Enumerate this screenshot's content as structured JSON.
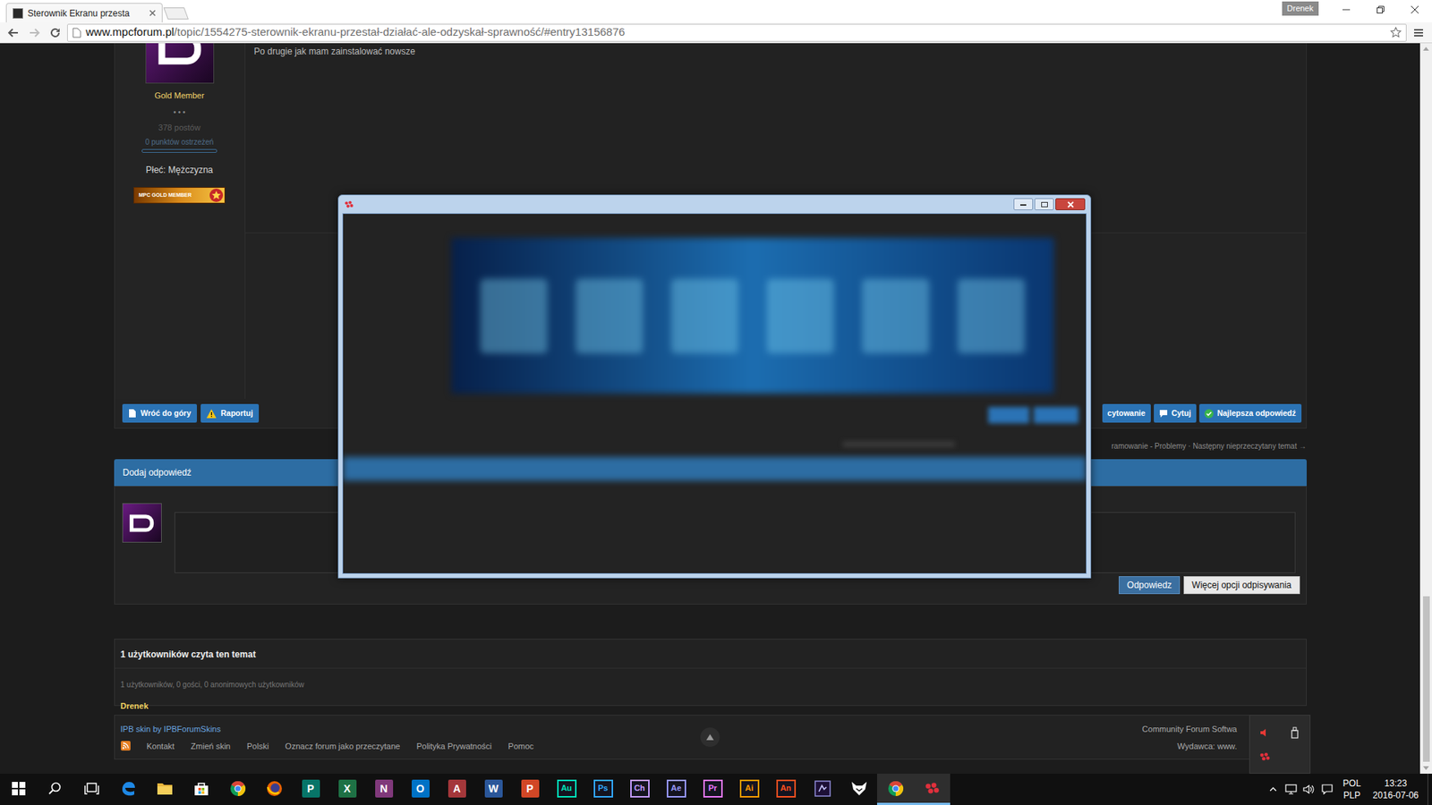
{
  "browser": {
    "tab": {
      "title": "Sterownik Ekranu przesta",
      "selected": true
    },
    "profile": "Drenek",
    "url": {
      "host": "www.mpcforum.pl",
      "path": "/topic/1554275-sterownik-ekranu-przestał-działać-ale-odzyskał-sprawność/#entry13156876"
    },
    "bookmarked": false
  },
  "post": {
    "text": "Po drugie jak mam zainstalować nowsze",
    "author": {
      "rank": "Gold Member",
      "dots": "• • •",
      "posts": "378 postów",
      "warnings": "0 punktów ostrzeżeń",
      "warning_level": 0,
      "gender": "Płeć: Mężczyzna",
      "badge": "MPC GOLD MEMBER"
    },
    "actions_left": [
      {
        "label": "Wróć do góry"
      },
      {
        "label": "Raportuj"
      }
    ],
    "actions_right": [
      {
        "label": "cytowanie"
      },
      {
        "label": "Cytuj"
      },
      {
        "label": "Najlepsza odpowiedź"
      }
    ]
  },
  "topic_nav": "ramowanie - Problemy · Następny nieprzeczytany temat →",
  "reply": {
    "title": "Dodaj odpowiedź",
    "buttons": [
      {
        "label": "Odpowiedz",
        "primary": true
      },
      {
        "label": "Więcej opcji odpisywania",
        "primary": false
      }
    ]
  },
  "readers": {
    "title": "1 użytkowników czyta ten temat",
    "summary": "1 użytkowników, 0 gości, 0 anonimowych użytkowników",
    "users": [
      "Drenek"
    ]
  },
  "footer": {
    "skin": "IPB skin by IPBForumSkins",
    "links": [
      "Kontakt",
      "Zmień skin",
      "Polski",
      "Oznacz forum jako przeczytane",
      "Polityka Prywatności",
      "Pomoc"
    ],
    "right": [
      "Community Forum Softwa",
      "Wydawca: www."
    ]
  },
  "taskbar": {
    "icons_left": [
      {
        "active": false
      },
      {
        "active": false
      },
      {
        "active": false
      },
      {
        "active": false
      },
      {
        "active": false
      },
      {
        "active": false
      },
      {
        "active": false
      },
      {
        "active": false
      }
    ],
    "apps": [
      {
        "label": "P",
        "kind": "office",
        "color": "#077568",
        "active": false
      },
      {
        "label": "X",
        "kind": "office",
        "color": "#1e7145",
        "active": false
      },
      {
        "label": "N",
        "kind": "office",
        "color": "#80397b",
        "active": false
      },
      {
        "label": "O",
        "kind": "office",
        "color": "#0072c6",
        "active": false
      },
      {
        "label": "A",
        "kind": "office",
        "color": "#a4373a",
        "active": false
      },
      {
        "label": "W",
        "kind": "office",
        "color": "#2b579a",
        "active": false
      },
      {
        "label": "P",
        "kind": "office",
        "color": "#d24726",
        "active": false
      },
      {
        "label": "Au",
        "kind": "adobe",
        "color": "#00e4bb",
        "active": false
      },
      {
        "label": "Ps",
        "kind": "adobe",
        "color": "#31a8ff",
        "active": false
      },
      {
        "label": "Ch",
        "kind": "adobe",
        "color": "#c49bff",
        "active": false
      },
      {
        "label": "Ae",
        "kind": "adobe",
        "color": "#9999ff",
        "active": false
      },
      {
        "label": "Pr",
        "kind": "adobe",
        "color": "#ea77ff",
        "active": false
      },
      {
        "label": "Ai",
        "kind": "adobe",
        "color": "#ff9a00",
        "active": false
      },
      {
        "label": "An",
        "kind": "adobe",
        "color": "#ff4f1f",
        "active": false
      }
    ],
    "icons_right": [
      {
        "active": false
      },
      {
        "active": false
      },
      {
        "active": true
      },
      {
        "active": true
      }
    ],
    "tray": {
      "language": "POL",
      "layout": "PLP",
      "time": "13:23",
      "date": "2016-07-06"
    }
  }
}
